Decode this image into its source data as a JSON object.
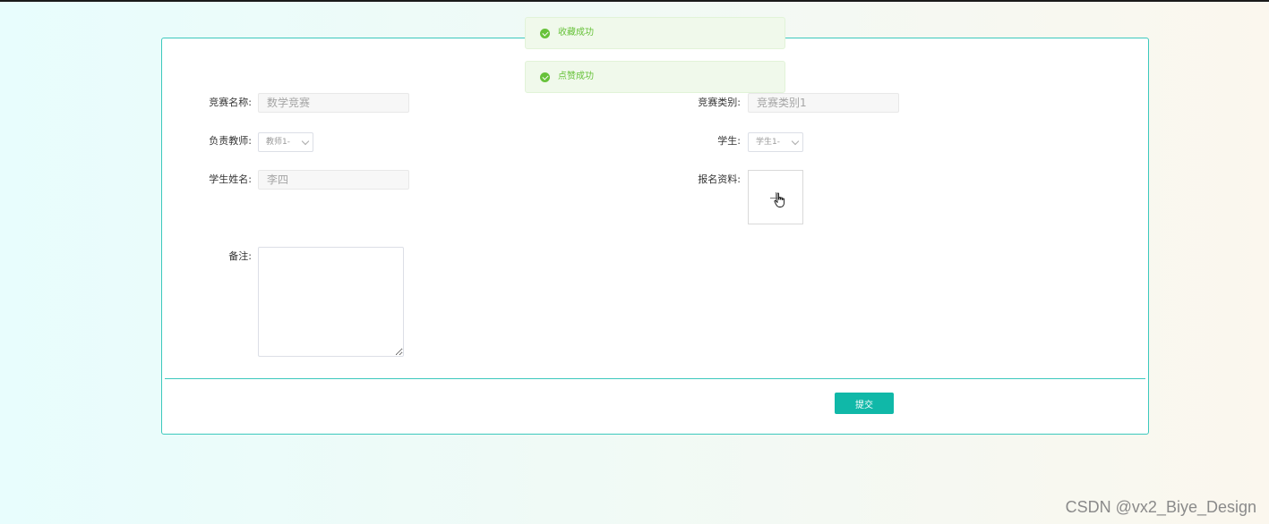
{
  "notifications": [
    {
      "text": "收藏成功"
    },
    {
      "text": "点赞成功"
    }
  ],
  "form": {
    "competition_name": {
      "label": "竞赛名称:",
      "value": "数学竞赛"
    },
    "competition_category": {
      "label": "竞赛类别:",
      "value": "竞赛类别1"
    },
    "teacher": {
      "label": "负责教师:",
      "value": "教师1-"
    },
    "student": {
      "label": "学生:",
      "value": "学生1-"
    },
    "student_name": {
      "label": "学生姓名:",
      "value": "李四"
    },
    "materials": {
      "label": "报名资料:"
    },
    "remarks": {
      "label": "备注:",
      "value": ""
    },
    "submit_label": "提交"
  },
  "watermark": "CSDN @vx2_Biye_Design",
  "colors": {
    "accent": "#10b8a8",
    "panel_border": "#3cc8bd",
    "success": "#67c23a"
  }
}
